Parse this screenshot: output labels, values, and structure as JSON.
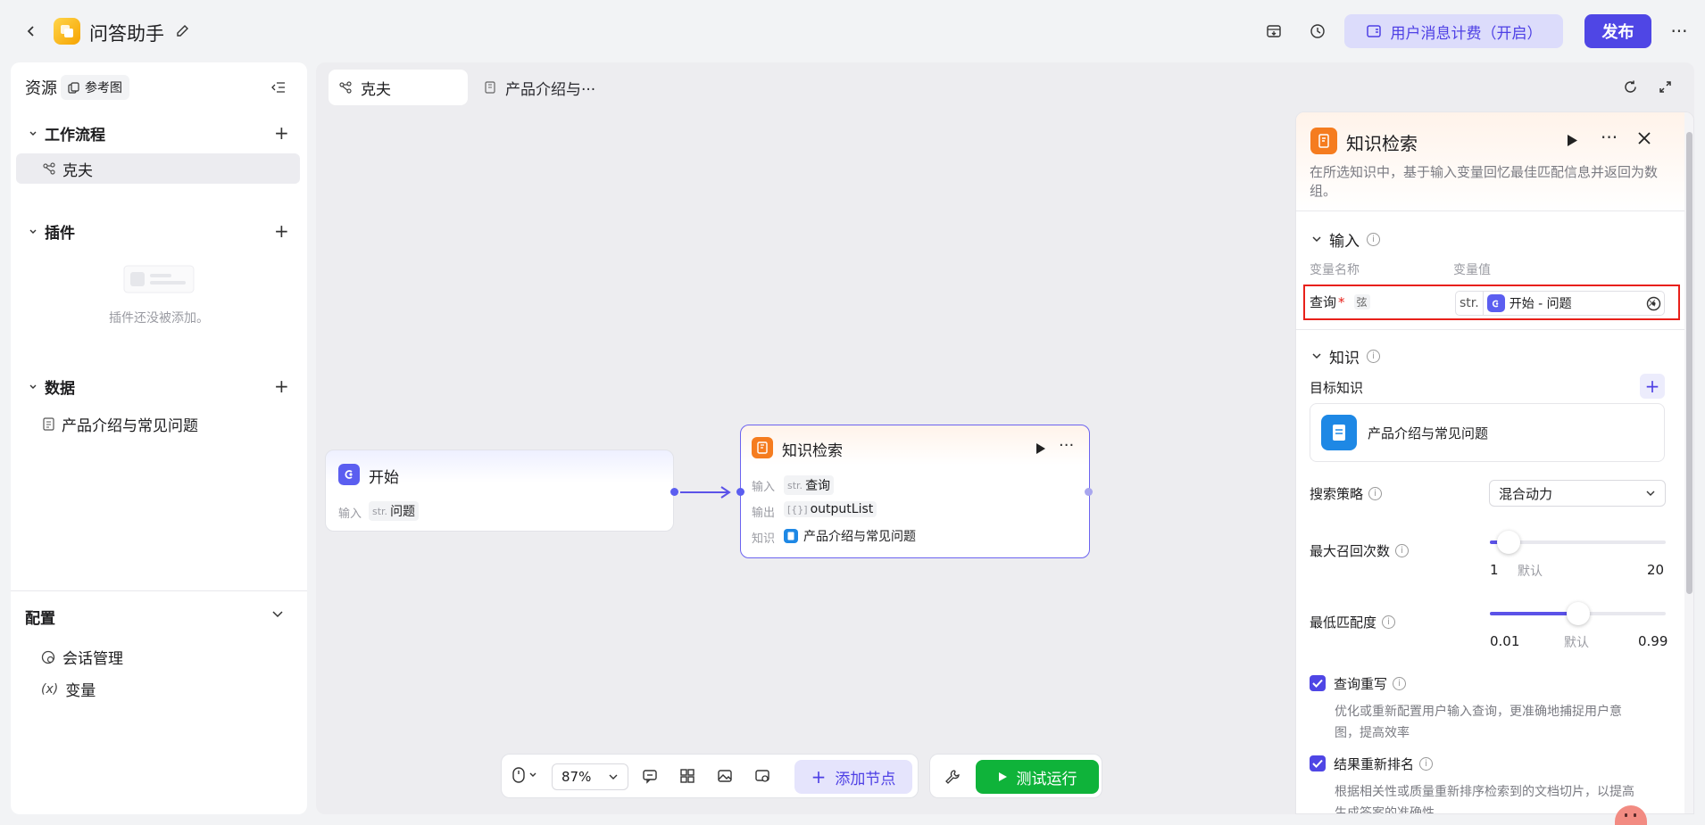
{
  "app": {
    "title": "问答助手"
  },
  "header": {
    "billing_label": "用户消息计费（开启）",
    "publish_label": "发布"
  },
  "sidebar": {
    "title": "资源",
    "ref_chip": "参考图",
    "workflow": {
      "title": "工作流程",
      "items": [
        "克夫"
      ]
    },
    "plugins": {
      "title": "插件",
      "empty": "插件还没被添加。"
    },
    "data": {
      "title": "数据",
      "items": [
        "产品介绍与常见问题"
      ]
    },
    "config": {
      "title": "配置",
      "items": [
        "会话管理",
        "变量"
      ]
    }
  },
  "tabs": [
    {
      "label": "克夫"
    },
    {
      "label": "产品介绍与···"
    }
  ],
  "nodes": {
    "start": {
      "title": "开始",
      "input_label": "输入",
      "input_type": "str.",
      "input_value": "问题"
    },
    "knowledge": {
      "title": "知识检索",
      "input_label": "输入",
      "input_type": "str.",
      "input_value": "查询",
      "output_label": "输出",
      "output_type": "[{}]",
      "output_value": "outputList",
      "knowledge_label": "知识",
      "knowledge_value": "产品介绍与常见问题"
    }
  },
  "toolbar": {
    "zoom": "87%",
    "add_node": "添加节点",
    "test_run": "测试运行"
  },
  "panel": {
    "title": "知识检索",
    "description": "在所选知识中，基于输入变量回忆最佳匹配信息并返回为数组。",
    "input_section": "输入",
    "col_name": "变量名称",
    "col_value": "变量值",
    "query_name": "查询",
    "query_required": "*",
    "query_type_tag": "弦",
    "value_type": "str.",
    "value_ref": "开始 - 问题",
    "knowledge_section": "知识",
    "target_knowledge": "目标知识",
    "knowledge_item": "产品介绍与常见问题",
    "search_strategy_label": "搜索策略",
    "search_strategy_value": "混合动力",
    "max_recall_label": "最大召回次数",
    "max_recall": {
      "min": "1",
      "default": "默认",
      "max": "20",
      "value": 3
    },
    "min_match_label": "最低匹配度",
    "min_match": {
      "min": "0.01",
      "default": "默认",
      "max": "0.99",
      "value": 0.5
    },
    "rewrite_label": "查询重写",
    "rewrite_desc_1": "优化或重新配置用户输入查询，更准确地捕捉用户意",
    "rewrite_desc_2": "图，提高效率",
    "rerank_label": "结果重新排名",
    "rerank_desc_1": "根据相关性或质量重新排序检索到的文档切片，以提高",
    "rerank_desc_2": "生成答案的准确性"
  },
  "colors": {
    "accent": "#4f46e5",
    "run_green": "#0fb33a",
    "highlight_red": "#e8201a",
    "knowledge_orange": "#f57c1f"
  }
}
